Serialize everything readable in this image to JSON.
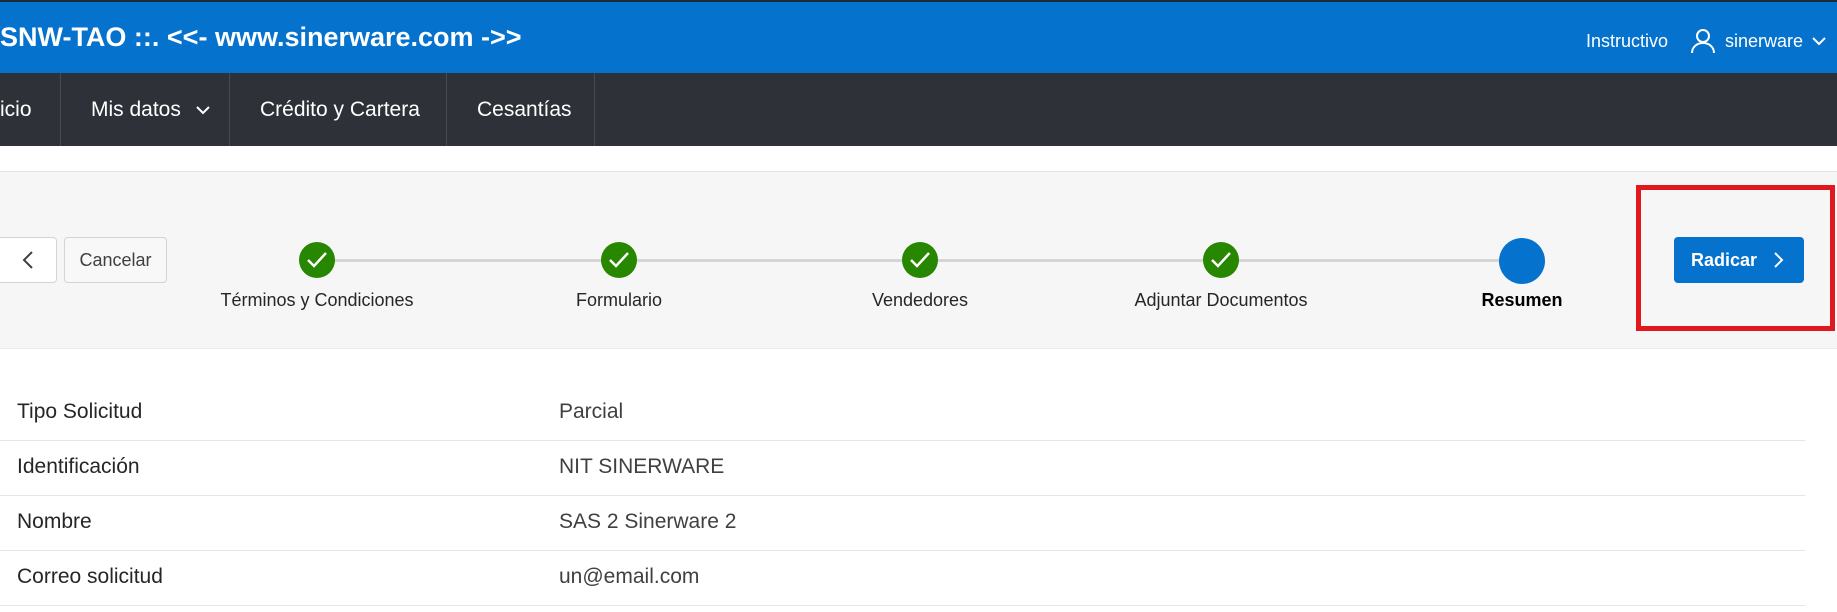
{
  "header": {
    "title": "SNW-TAO ::. <<- www.sinerware.com ->>",
    "links": {
      "instructivo": "Instructivo"
    },
    "user": {
      "name": "sinerware",
      "icon": "user-icon"
    },
    "background": "#0572ce"
  },
  "nav": {
    "items": [
      {
        "label": "icio"
      },
      {
        "label": "Mis datos",
        "has_dropdown": true
      },
      {
        "label": "Crédito y Cartera"
      },
      {
        "label": "Cesantías"
      }
    ],
    "background": "#2e3238"
  },
  "wizard": {
    "cancel_label": "Cancelar",
    "submit_label": "Radicar",
    "steps": [
      {
        "label": "Términos y Condiciones",
        "status": "complete"
      },
      {
        "label": "Formulario",
        "status": "complete"
      },
      {
        "label": "Vendedores",
        "status": "complete"
      },
      {
        "label": "Adjuntar Documentos",
        "status": "complete"
      },
      {
        "label": "Resumen",
        "status": "current"
      }
    ],
    "colors": {
      "complete": "#278701",
      "current": "#0572ce",
      "highlight": "#e2181f"
    }
  },
  "summary": {
    "rows": [
      {
        "label": "Tipo Solicitud",
        "value": "Parcial"
      },
      {
        "label": "Identificación",
        "value": "NIT SINERWARE"
      },
      {
        "label": "Nombre",
        "value": "SAS 2 Sinerware 2"
      },
      {
        "label": "Correo solicitud",
        "value": "un@email.com"
      }
    ]
  }
}
